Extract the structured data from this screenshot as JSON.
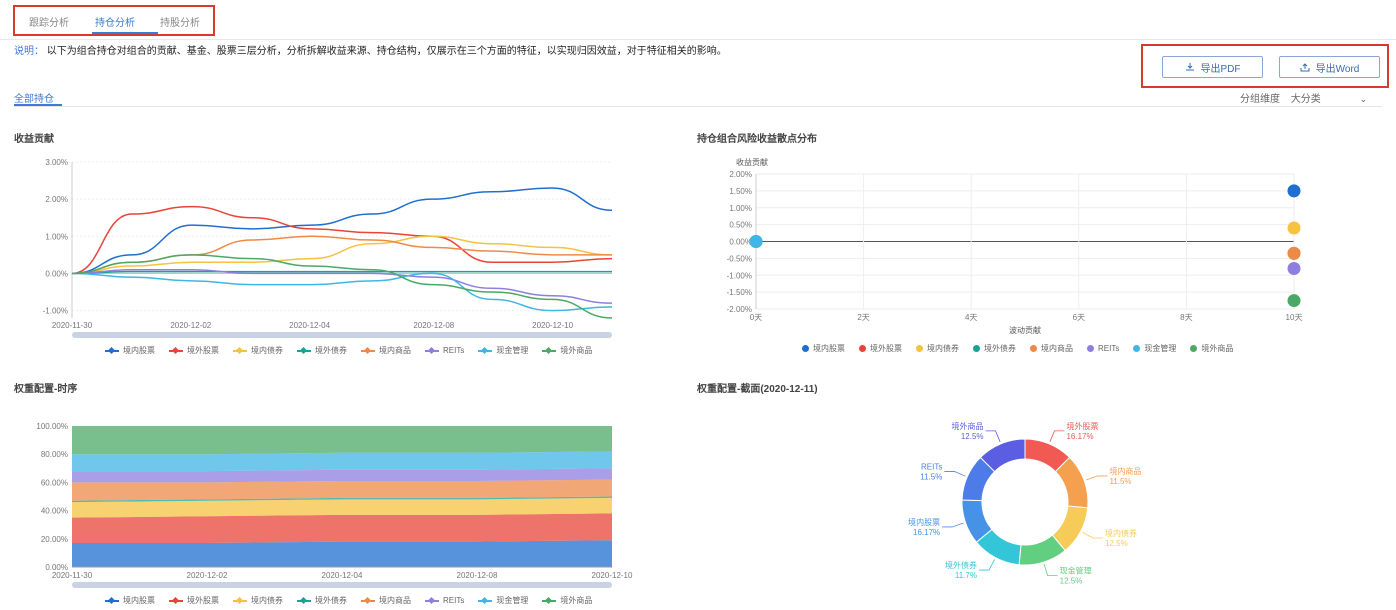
{
  "tabs": [
    {
      "label": "跟踪分析"
    },
    {
      "label": "持仓分析"
    },
    {
      "label": "持股分析"
    }
  ],
  "note": {
    "label": "说明：",
    "text": "以下为组合持仓对组合的贡献、基金、股票三层分析，分析拆解收益来源、持仓结构，仅展示在三个方面的特征，以实现归因效益，对于特征相关的影响。"
  },
  "export": {
    "pdf_label": "导出PDF",
    "word_label": "导出Word"
  },
  "section": {
    "tab_label": "全部持仓",
    "dim_label": "分组维度",
    "dim_value": "大分类"
  },
  "legend_items": [
    {
      "name": "境内股票",
      "color": "#1f6fd1"
    },
    {
      "name": "境外股票",
      "color": "#e8443a"
    },
    {
      "name": "境内债券",
      "color": "#f5c242"
    },
    {
      "name": "境外债券",
      "color": "#17a398"
    },
    {
      "name": "境内商品",
      "color": "#ee8a48"
    },
    {
      "name": "REITs",
      "color": "#8e7ee0"
    },
    {
      "name": "现金管理",
      "color": "#3fb6e6"
    },
    {
      "name": "境外商品",
      "color": "#4ca867"
    }
  ],
  "chart1": {
    "title": "收益贡献",
    "dates": [
      "2020-11-30",
      "2020-12-02",
      "2020-12-04",
      "2020-12-08",
      "2020-12-10"
    ],
    "yticks": [
      "-1.00%",
      "0.00%",
      "1.00%",
      "2.00%",
      "3.00%"
    ]
  },
  "chart2": {
    "title": "持仓组合风险收益散点分布",
    "ylabel": "收益贡献",
    "xlabel": "波动贡献",
    "yticks": [
      "-2.00%",
      "-1.50%",
      "-1.00%",
      "-0.50%",
      "0.00%",
      "0.50%",
      "1.00%",
      "1.50%",
      "2.00%"
    ],
    "xticks": [
      "0天",
      "2天",
      "4天",
      "6天",
      "8天",
      "10天"
    ]
  },
  "chart3": {
    "title": "权重配置-时序",
    "yticks": [
      "0.00%",
      "20.00%",
      "40.00%",
      "60.00%",
      "80.00%",
      "100.00%"
    ],
    "dates": [
      "2020-11-30",
      "2020-12-02",
      "2020-12-04",
      "2020-12-08",
      "2020-12-10"
    ]
  },
  "chart4": {
    "title": "权重配置-截面(2020-12-11)",
    "labels": [
      {
        "name": "境内股票",
        "pct": "16.17%"
      },
      {
        "name": "境外股票",
        "pct": "16.17%"
      },
      {
        "name": "境内债券",
        "pct": "12.5%"
      },
      {
        "name": "境外债券",
        "pct": "11.7%"
      },
      {
        "name": "境内商品",
        "pct": "11.5%"
      },
      {
        "name": "REITs",
        "pct": "11.5%"
      },
      {
        "name": "现金管理",
        "pct": "12.5%"
      },
      {
        "name": "境外商品",
        "pct": "12.5%"
      }
    ]
  },
  "chart_data": [
    {
      "type": "line",
      "title": "收益贡献",
      "x": [
        "2020-11-30",
        "2020-12-01",
        "2020-12-02",
        "2020-12-03",
        "2020-12-04",
        "2020-12-07",
        "2020-12-08",
        "2020-12-09",
        "2020-12-10",
        "2020-12-11"
      ],
      "ylim": [
        -1.2,
        3.0
      ],
      "series": [
        {
          "name": "境内股票",
          "values": [
            0.0,
            0.5,
            1.3,
            1.2,
            1.3,
            1.6,
            2.0,
            2.2,
            2.3,
            1.7
          ]
        },
        {
          "name": "境外股票",
          "values": [
            0.0,
            1.6,
            1.8,
            1.5,
            1.2,
            1.1,
            1.0,
            0.3,
            0.3,
            0.4
          ]
        },
        {
          "name": "境内债券",
          "values": [
            0.0,
            0.2,
            0.3,
            0.3,
            0.4,
            0.8,
            1.0,
            0.8,
            0.7,
            0.5
          ]
        },
        {
          "name": "境外债券",
          "values": [
            0.0,
            0.05,
            0.05,
            0.05,
            0.05,
            0.05,
            0.05,
            0.05,
            0.05,
            0.05
          ]
        },
        {
          "name": "境内商品",
          "values": [
            0.0,
            0.3,
            0.5,
            0.9,
            1.0,
            0.9,
            0.7,
            0.6,
            0.5,
            0.5
          ]
        },
        {
          "name": "REITs",
          "values": [
            0.0,
            0.1,
            0.1,
            0.0,
            0.0,
            0.0,
            -0.1,
            -0.4,
            -0.6,
            -0.8
          ]
        },
        {
          "name": "现金管理",
          "values": [
            0.0,
            -0.1,
            -0.2,
            -0.3,
            -0.3,
            -0.2,
            0.0,
            -0.7,
            -1.0,
            -0.9
          ]
        },
        {
          "name": "境外商品",
          "values": [
            0.0,
            0.3,
            0.5,
            0.4,
            0.2,
            0.1,
            -0.3,
            -0.5,
            -0.7,
            -1.2
          ]
        }
      ]
    },
    {
      "type": "scatter",
      "title": "持仓组合风险收益散点分布",
      "xlabel": "波动贡献",
      "ylabel": "收益贡献",
      "xlim": [
        0,
        10
      ],
      "ylim": [
        -2.0,
        2.0
      ],
      "series": [
        {
          "name": "境内股票",
          "x": [
            10
          ],
          "y": [
            1.5
          ]
        },
        {
          "name": "境外股票",
          "x": [
            10
          ],
          "y": [
            -0.35
          ]
        },
        {
          "name": "境内债券",
          "x": [
            10
          ],
          "y": [
            0.4
          ]
        },
        {
          "name": "境外债券",
          "x": [
            0
          ],
          "y": [
            0.0
          ]
        },
        {
          "name": "境内商品",
          "x": [
            10
          ],
          "y": [
            -0.35
          ]
        },
        {
          "name": "REITs",
          "x": [
            10
          ],
          "y": [
            -0.8
          ]
        },
        {
          "name": "现金管理",
          "x": [
            0
          ],
          "y": [
            0.0
          ]
        },
        {
          "name": "境外商品",
          "x": [
            10
          ],
          "y": [
            -1.75
          ]
        }
      ]
    },
    {
      "type": "area",
      "title": "权重配置-时序",
      "ylim": [
        0,
        100
      ],
      "x": [
        "2020-11-30",
        "2020-12-02",
        "2020-12-04",
        "2020-12-08",
        "2020-12-10"
      ],
      "series": [
        {
          "name": "境内股票",
          "values": [
            17,
            17,
            18,
            18,
            19
          ]
        },
        {
          "name": "境外股票",
          "values": [
            18,
            19,
            19,
            19,
            19
          ]
        },
        {
          "name": "境内债券",
          "values": [
            11,
            11,
            11,
            11,
            11
          ]
        },
        {
          "name": "境外债券",
          "values": [
            1,
            1,
            1,
            1,
            1
          ]
        },
        {
          "name": "境内商品",
          "values": [
            13,
            12,
            12,
            12,
            12
          ]
        },
        {
          "name": "REITs",
          "values": [
            8,
            8,
            8,
            8,
            8
          ]
        },
        {
          "name": "现金管理",
          "values": [
            12,
            12,
            12,
            12,
            12
          ]
        },
        {
          "name": "境外商品",
          "values": [
            20,
            20,
            19,
            19,
            18
          ]
        }
      ]
    },
    {
      "type": "pie",
      "title": "权重配置-截面(2020-12-11)",
      "categories": [
        "境外股票",
        "境内商品",
        "境内债券",
        "现金管理",
        "境外债券",
        "境内股票",
        "REITs",
        "境外商品"
      ],
      "values": [
        12.5,
        14.0,
        12.5,
        12.5,
        12.5,
        11.5,
        12.0,
        12.5
      ],
      "colors": [
        "#f05a52",
        "#f5a04f",
        "#f7cb57",
        "#62cf80",
        "#33c6d8",
        "#4692e7",
        "#4d7ce8",
        "#5b5de2"
      ]
    }
  ]
}
